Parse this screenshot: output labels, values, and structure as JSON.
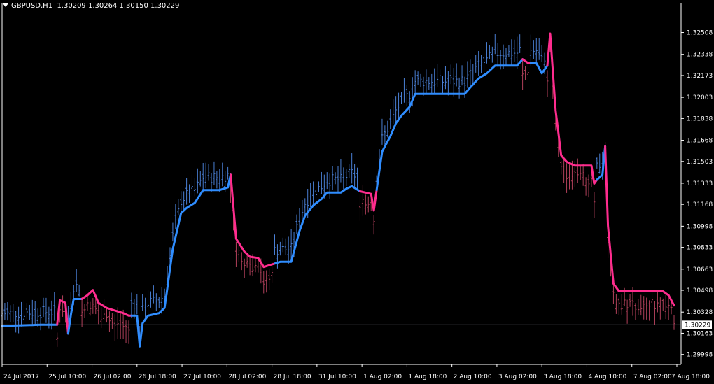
{
  "header": {
    "symbol": "GBPUSD,H1",
    "ohlc": "1.30209 1.30264 1.30150 1.30229"
  },
  "colors": {
    "background": "#000000",
    "axis": "#ffffff",
    "bull_bar": "#4a7fd4",
    "bear_bar": "#b0405a",
    "ma_up": "#2f8dff",
    "ma_down": "#ff2c8e",
    "price_line": "#8a8a9a"
  },
  "chart_data": {
    "type": "line",
    "y_ticks": [
      "1.32508",
      "1.32338",
      "1.32173",
      "1.32003",
      "1.31838",
      "1.31668",
      "1.31503",
      "1.31333",
      "1.31168",
      "1.30998",
      "1.30833",
      "1.30663",
      "1.30498",
      "1.30328",
      "1.30163",
      "1.29998"
    ],
    "ylim": [
      1.2992,
      1.3274
    ],
    "x_ticks": [
      "24 Jul 2017",
      "25 Jul 10:00",
      "26 Jul 02:00",
      "26 Jul 18:00",
      "27 Jul 10:00",
      "28 Jul 02:00",
      "28 Jul 18:00",
      "31 Jul 10:00",
      "1 Aug 02:00",
      "1 Aug 18:00",
      "2 Aug 10:00",
      "3 Aug 02:00",
      "3 Aug 18:00",
      "4 Aug 10:00",
      "7 Aug 02:00",
      "7 Aug 18:00"
    ],
    "current_price": "1.30229",
    "current_price_value": 1.30229,
    "bar_count": 225,
    "ma": [
      {
        "i": 0,
        "v": 1.3022
      },
      {
        "i": 15,
        "v": 1.3023
      },
      {
        "i": 20,
        "v": 1.3023
      },
      {
        "i": 21,
        "v": 1.3042
      },
      {
        "i": 23,
        "v": 1.304
      },
      {
        "i": 24,
        "v": 1.3016
      },
      {
        "i": 25,
        "v": 1.3031
      },
      {
        "i": 26,
        "v": 1.3043
      },
      {
        "i": 29,
        "v": 1.3043
      },
      {
        "i": 31,
        "v": 1.3046
      },
      {
        "i": 33,
        "v": 1.305
      },
      {
        "i": 35,
        "v": 1.304
      },
      {
        "i": 38,
        "v": 1.3036
      },
      {
        "i": 44,
        "v": 1.3032
      },
      {
        "i": 46,
        "v": 1.303
      },
      {
        "i": 49,
        "v": 1.303
      },
      {
        "i": 50,
        "v": 1.3006
      },
      {
        "i": 51,
        "v": 1.3024
      },
      {
        "i": 53,
        "v": 1.303
      },
      {
        "i": 57,
        "v": 1.3032
      },
      {
        "i": 59,
        "v": 1.3036
      },
      {
        "i": 62,
        "v": 1.3082
      },
      {
        "i": 65,
        "v": 1.311
      },
      {
        "i": 67,
        "v": 1.3114
      },
      {
        "i": 70,
        "v": 1.3118
      },
      {
        "i": 73,
        "v": 1.3128
      },
      {
        "i": 76,
        "v": 1.3128
      },
      {
        "i": 79,
        "v": 1.3128
      },
      {
        "i": 82,
        "v": 1.313
      },
      {
        "i": 83,
        "v": 1.314
      },
      {
        "i": 85,
        "v": 1.309
      },
      {
        "i": 88,
        "v": 1.308
      },
      {
        "i": 90,
        "v": 1.3076
      },
      {
        "i": 93,
        "v": 1.3075
      },
      {
        "i": 95,
        "v": 1.3068
      },
      {
        "i": 98,
        "v": 1.307
      },
      {
        "i": 101,
        "v": 1.3072
      },
      {
        "i": 105,
        "v": 1.3072
      },
      {
        "i": 108,
        "v": 1.3096
      },
      {
        "i": 110,
        "v": 1.3108
      },
      {
        "i": 113,
        "v": 1.3116
      },
      {
        "i": 116,
        "v": 1.3121
      },
      {
        "i": 118,
        "v": 1.3126
      },
      {
        "i": 121,
        "v": 1.3126
      },
      {
        "i": 123,
        "v": 1.3126
      },
      {
        "i": 125,
        "v": 1.3129
      },
      {
        "i": 127,
        "v": 1.3131
      },
      {
        "i": 130,
        "v": 1.3127
      },
      {
        "i": 132,
        "v": 1.3126
      },
      {
        "i": 134,
        "v": 1.3125
      },
      {
        "i": 135,
        "v": 1.3112
      },
      {
        "i": 136,
        "v": 1.3128
      },
      {
        "i": 138,
        "v": 1.3158
      },
      {
        "i": 141,
        "v": 1.317
      },
      {
        "i": 143,
        "v": 1.318
      },
      {
        "i": 145,
        "v": 1.3186
      },
      {
        "i": 148,
        "v": 1.3193
      },
      {
        "i": 150,
        "v": 1.3203
      },
      {
        "i": 156,
        "v": 1.3203
      },
      {
        "i": 162,
        "v": 1.3203
      },
      {
        "i": 168,
        "v": 1.3203
      },
      {
        "i": 170,
        "v": 1.3208
      },
      {
        "i": 173,
        "v": 1.3215
      },
      {
        "i": 176,
        "v": 1.3219
      },
      {
        "i": 179,
        "v": 1.3225
      },
      {
        "i": 185,
        "v": 1.3225
      },
      {
        "i": 187,
        "v": 1.3225
      },
      {
        "i": 189,
        "v": 1.323
      },
      {
        "i": 191,
        "v": 1.3227
      },
      {
        "i": 194,
        "v": 1.3227
      },
      {
        "i": 196,
        "v": 1.3219
      },
      {
        "i": 198,
        "v": 1.3225
      },
      {
        "i": 199,
        "v": 1.325
      },
      {
        "i": 201,
        "v": 1.319
      },
      {
        "i": 203,
        "v": 1.3155
      },
      {
        "i": 205,
        "v": 1.315
      },
      {
        "i": 208,
        "v": 1.3147
      },
      {
        "i": 212,
        "v": 1.3147
      },
      {
        "i": 214,
        "v": 1.3147
      },
      {
        "i": 215,
        "v": 1.3133
      },
      {
        "i": 216,
        "v": 1.3136
      },
      {
        "i": 218,
        "v": 1.314
      },
      {
        "i": 219,
        "v": 1.3162
      },
      {
        "i": 220,
        "v": 1.31
      },
      {
        "i": 222,
        "v": 1.3055
      },
      {
        "i": 224,
        "v": 1.3049
      },
      {
        "i": 230,
        "v": 1.3049
      },
      {
        "i": 236,
        "v": 1.3049
      },
      {
        "i": 240,
        "v": 1.3049
      },
      {
        "i": 242,
        "v": 1.3046
      },
      {
        "i": 244,
        "v": 1.3038
      }
    ],
    "ma_down_ranges": [
      [
        20,
        23
      ],
      [
        29,
        46
      ],
      [
        83,
        98
      ],
      [
        130,
        135
      ],
      [
        189,
        191
      ],
      [
        198,
        215
      ],
      [
        219,
        244
      ]
    ]
  }
}
